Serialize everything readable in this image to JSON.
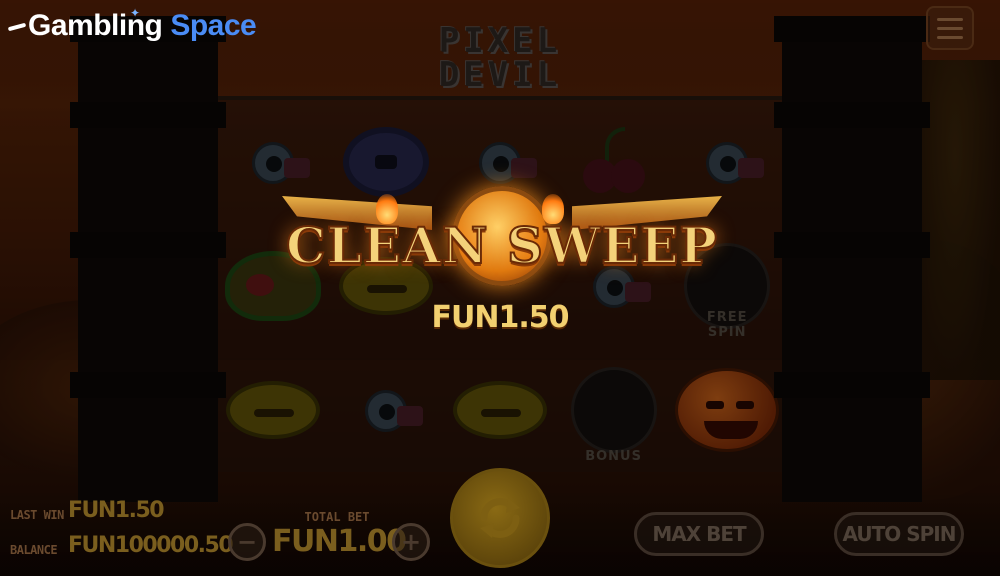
{
  "brand": {
    "word1": "Gambling",
    "word2": "Space"
  },
  "game": {
    "logo_line1": "PIXEL",
    "logo_line2": "DEVIL"
  },
  "reels": {
    "wild_label": "FREE SPIN",
    "bonus_label": "BONUS"
  },
  "win": {
    "title": "CLEAN SWEEP",
    "amount": "FUN1.50"
  },
  "stats": {
    "last_win_label": "LAST WIN",
    "last_win_value": "FUN1.50",
    "balance_label": "BALANCE",
    "balance_value": "FUN100000.50"
  },
  "bet": {
    "total_label": "TOTAL BET",
    "total_value": "FUN1.00",
    "minus_glyph": "−",
    "plus_glyph": "+"
  },
  "buttons": {
    "max_bet": "MAX BET",
    "auto_spin": "AUTO SPIN"
  },
  "colors": {
    "brand_blue": "#4a8cf5",
    "gold": "#f4d27a"
  }
}
